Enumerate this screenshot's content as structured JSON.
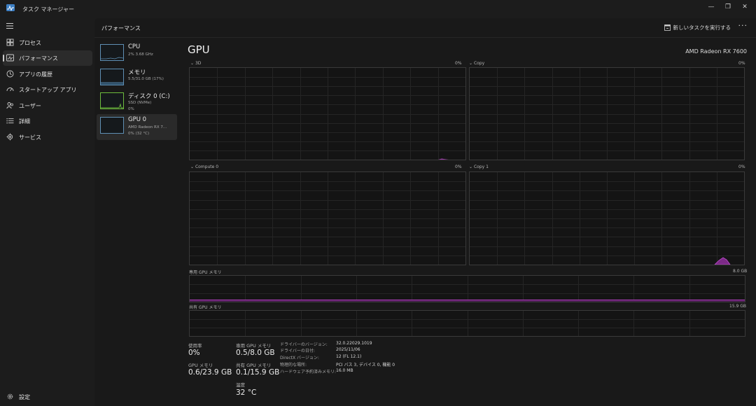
{
  "window": {
    "title": "タスク マネージャー",
    "controls": {
      "minimize": "—",
      "restore": "❐",
      "close": "✕"
    }
  },
  "sidebar": {
    "items": [
      {
        "label": "プロセス",
        "icon": "process-grid-icon"
      },
      {
        "label": "パフォーマンス",
        "icon": "performance-icon",
        "active": true
      },
      {
        "label": "アプリの履歴",
        "icon": "history-icon"
      },
      {
        "label": "スタートアップ アプリ",
        "icon": "startup-gauge-icon"
      },
      {
        "label": "ユーザー",
        "icon": "users-icon"
      },
      {
        "label": "詳細",
        "icon": "details-list-icon"
      },
      {
        "label": "サービス",
        "icon": "services-gear-icon"
      }
    ],
    "settings_label": "設定"
  },
  "header": {
    "title": "パフォーマンス",
    "run_task_label": "新しいタスクを実行する",
    "more_label": "···"
  },
  "devices": [
    {
      "name": "CPU",
      "detail": "2%  3.68 GHz",
      "color": "#5f8fb4"
    },
    {
      "name": "メモリ",
      "detail": "5.5/31.0 GB (17%)",
      "color": "#5f8fb4"
    },
    {
      "name": "ディスク 0 (C:)",
      "detail": "SSD (NVMe)",
      "detail2": "0%",
      "color": "#6dbb3d"
    },
    {
      "name": "GPU 0",
      "detail": "AMD Radeon RX 7...",
      "detail2": "0% (32 °C)",
      "color": "#5f8fb4",
      "active": true
    }
  ],
  "gpu": {
    "title": "GPU",
    "model": "AMD Radeon RX 7600",
    "engine_graphs": [
      {
        "label": "3D",
        "value": "0%"
      },
      {
        "label": "Copy",
        "value": "0%"
      },
      {
        "label": "Compute 0",
        "value": "0%"
      },
      {
        "label": "Copy 1",
        "value": "0%"
      }
    ],
    "dedicated_graph": {
      "label": "専用 GPU メモリ",
      "max": "8.0 GB"
    },
    "shared_graph": {
      "label": "共有 GPU メモリ",
      "max": "15.9 GB"
    },
    "accent_color": "#b13fbf",
    "stats": {
      "usage_label": "使用率",
      "usage_value": "0%",
      "gpu_mem_label": "GPU メモリ",
      "gpu_mem_value": "0.6/23.9 GB",
      "dedicated_label": "専用 GPU メモリ",
      "dedicated_value": "0.5/8.0 GB",
      "shared_label": "共有 GPU メモリ",
      "shared_value": "0.1/15.9 GB",
      "temp_label": "温度",
      "temp_value": "32 °C"
    },
    "info": [
      {
        "key": "ドライバーのバージョン:",
        "value": "32.0.22029.1019"
      },
      {
        "key": "ドライバーの日付:",
        "value": "2025/11/06"
      },
      {
        "key": "DirectX バージョン:",
        "value": "12 (FL 12.1)"
      },
      {
        "key": "物理的な場所:",
        "value": "PCI バス 3, デバイス 0, 機能 0"
      },
      {
        "key": "ハードウェア予約済みメモリ:",
        "value": "16.0 MB"
      }
    ]
  }
}
